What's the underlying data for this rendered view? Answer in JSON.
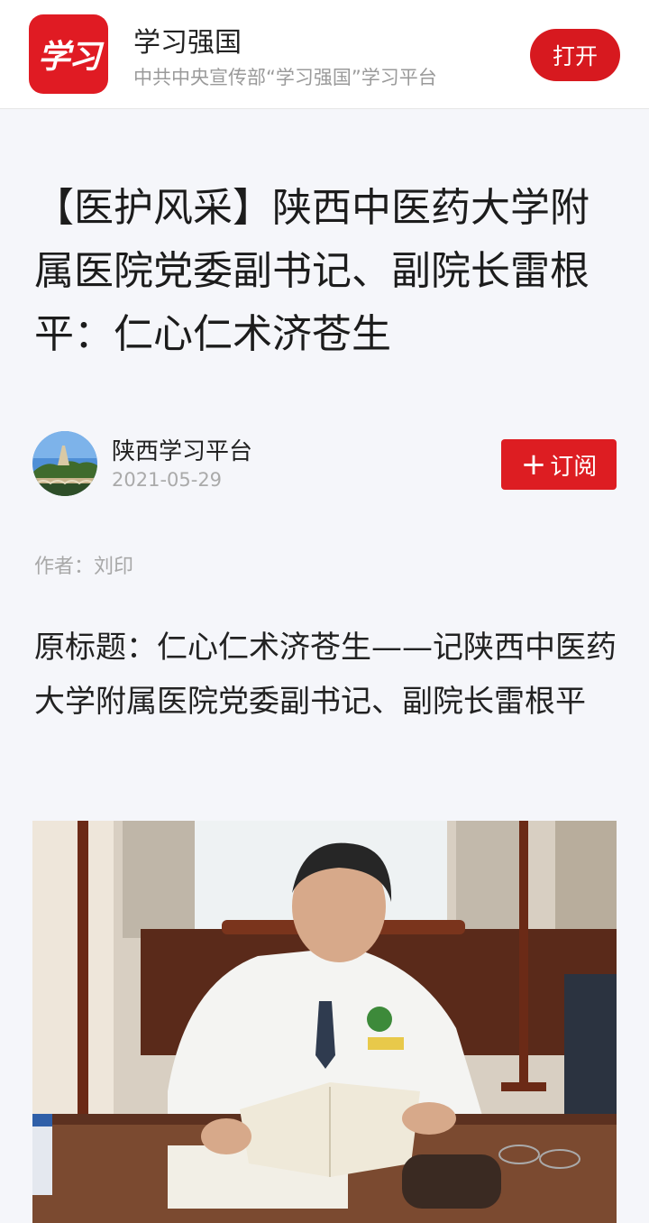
{
  "app_banner": {
    "logo_text": "学习",
    "name": "学习强国",
    "subtitle": "中共中央宣传部“学习强国”学习平台",
    "open_label": "打开",
    "brand_color": "#d7191f"
  },
  "article": {
    "title": "【医护风采】陕西中医药大学附属医院党委副书记、副院长雷根平：仁心仁术济苍生",
    "source": {
      "name": "陕西学习平台",
      "date": "2021-05-29",
      "subscribe_label": "订阅",
      "subscribe_icon": "plus-icon"
    },
    "byline": "作者：刘印",
    "original_title": "原标题：仁心仁术济苍生——记陕西中医药大学附属医院党委副书记、副院长雷根平"
  }
}
